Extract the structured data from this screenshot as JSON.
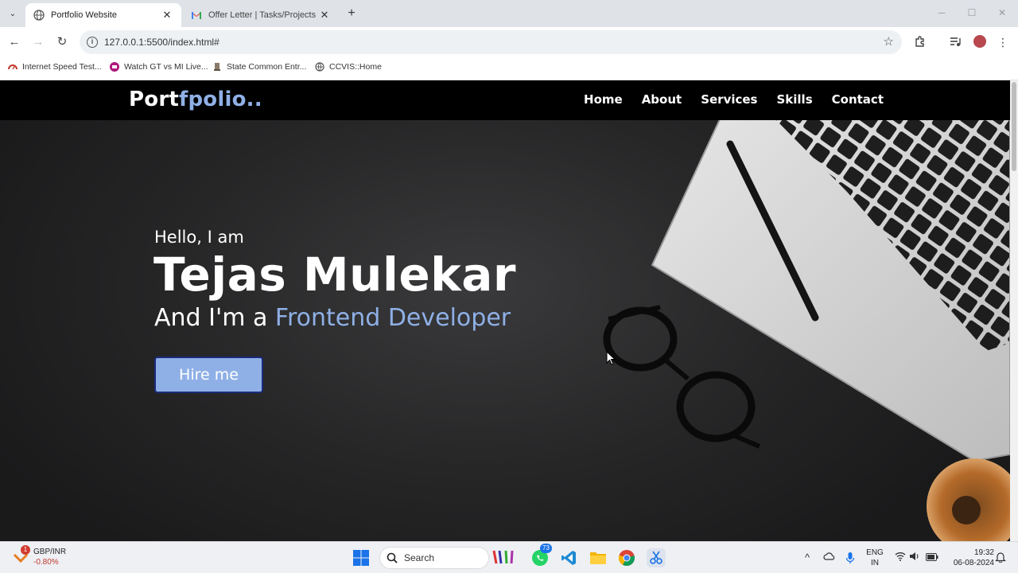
{
  "browser": {
    "tabs": [
      {
        "title": "Portfolio Website",
        "active": true
      },
      {
        "title": "Offer Letter | Tasks/Projects | C",
        "active": false
      }
    ],
    "url": "127.0.0.1:5500/index.html#",
    "bookmarks": [
      {
        "label": "Internet Speed Test..."
      },
      {
        "label": "Watch GT vs MI Live..."
      },
      {
        "label": "State Common Entr..."
      },
      {
        "label": "CCVIS::Home"
      }
    ]
  },
  "site": {
    "logo_main": "Port",
    "logo_accent": "fpolio..",
    "nav": [
      "Home",
      "About",
      "Services",
      "Skills",
      "Contact"
    ],
    "hero": {
      "greeting": "Hello, I am",
      "name": "Tejas Mulekar",
      "role_prefix": "And I'm a ",
      "role_highlight": "Frontend Developer",
      "cta": "Hire me"
    },
    "accent_color": "#8fb0e6"
  },
  "taskbar": {
    "ticker_badge": "1",
    "ticker_symbol": "GBP/INR",
    "ticker_change": "-0.80%",
    "search_label": "Search",
    "whatsapp_badge": "73",
    "language": "ENG",
    "region": "IN",
    "time": "19:32",
    "date": "06-08-2024"
  }
}
